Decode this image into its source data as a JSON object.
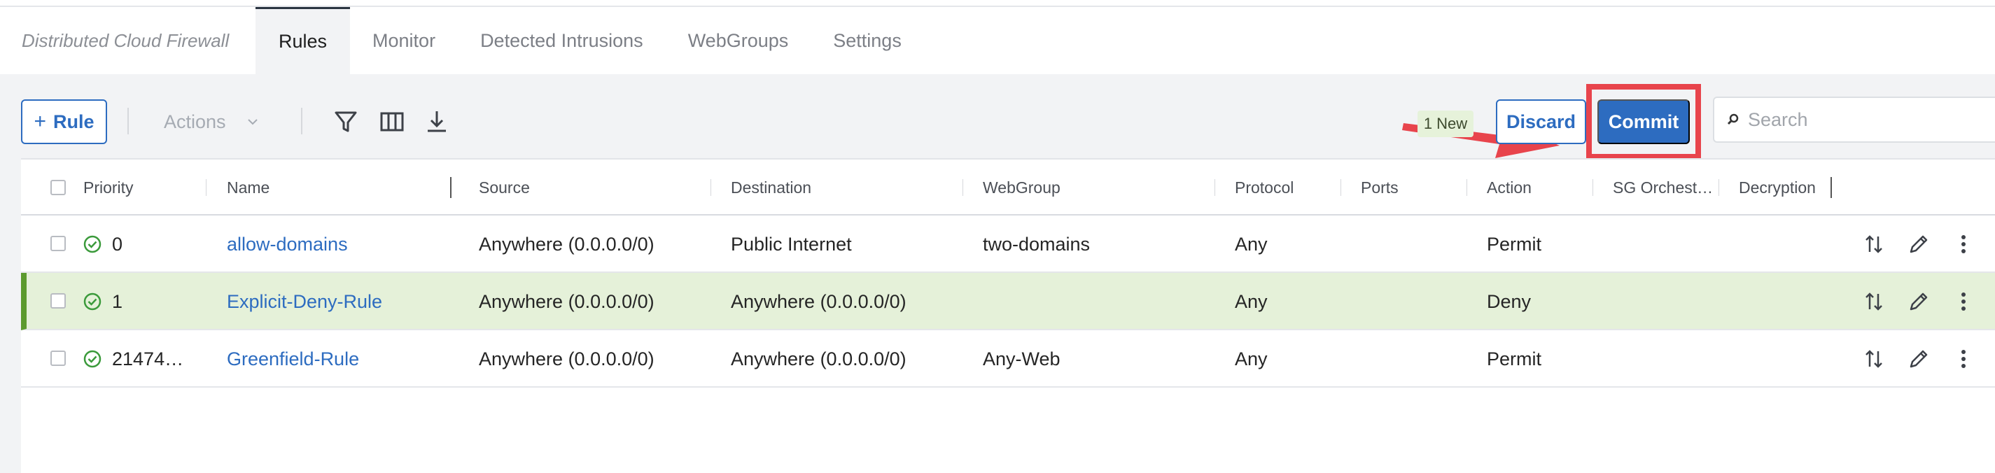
{
  "nav": {
    "title": "Distributed Cloud Firewall",
    "tabs": [
      {
        "label": "Rules"
      },
      {
        "label": "Monitor"
      },
      {
        "label": "Detected Intrusions"
      },
      {
        "label": "WebGroups"
      },
      {
        "label": "Settings"
      }
    ],
    "active_tab": "Rules"
  },
  "toolbar": {
    "add_rule_label": "Rule",
    "add_rule_icon": "plus-icon",
    "actions_label": "Actions",
    "new_badge": "1 New",
    "discard_label": "Discard",
    "commit_label": "Commit",
    "search_placeholder": "Search",
    "icons": [
      "filter-icon",
      "columns-icon",
      "download-icon",
      "search-icon"
    ],
    "callout_color": "#e8444c"
  },
  "table": {
    "columns": [
      "Priority",
      "Name",
      "Source",
      "Destination",
      "WebGroup",
      "Protocol",
      "Ports",
      "Action",
      "SG Orchest…",
      "Decryption"
    ],
    "rows": [
      {
        "priority": "0",
        "name": "allow-domains",
        "source": "Anywhere (0.0.0.0/0)",
        "destination": "Public Internet",
        "webgroup": "two-domains",
        "protocol": "Any",
        "ports": "",
        "action": "Permit",
        "sg": "",
        "decryption": "",
        "is_new": false
      },
      {
        "priority": "1",
        "name": "Explicit-Deny-Rule",
        "source": "Anywhere (0.0.0.0/0)",
        "destination": "Anywhere (0.0.0.0/0)",
        "webgroup": "",
        "protocol": "Any",
        "ports": "",
        "action": "Deny",
        "sg": "",
        "decryption": "",
        "is_new": true
      },
      {
        "priority": "21474…",
        "name": "Greenfield-Rule",
        "source": "Anywhere (0.0.0.0/0)",
        "destination": "Anywhere (0.0.0.0/0)",
        "webgroup": "Any-Web",
        "protocol": "Any",
        "ports": "",
        "action": "Permit",
        "sg": "",
        "decryption": "",
        "is_new": false
      }
    ],
    "row_icons": [
      "status-ok-icon",
      "reorder-icon",
      "edit-icon",
      "more-icon"
    ]
  },
  "colors": {
    "primary": "#2d6cc0",
    "new_row_bg": "#e5f1d9",
    "new_row_marker": "#5c9a2e",
    "status_ok": "#3b9a3b",
    "highlight_box": "#e8444c"
  }
}
